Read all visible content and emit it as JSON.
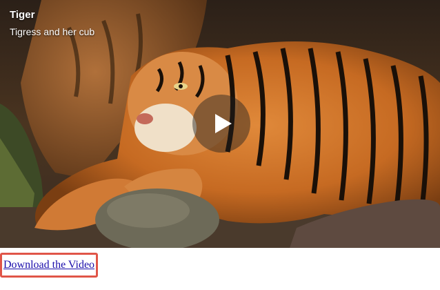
{
  "video": {
    "title": "Tiger",
    "subtitle": "Tigress and her cub",
    "play_icon": "play-icon"
  },
  "download": {
    "label": "Download the Video",
    "highlight_color": "#e05548",
    "link_color": "#1a0dab"
  }
}
